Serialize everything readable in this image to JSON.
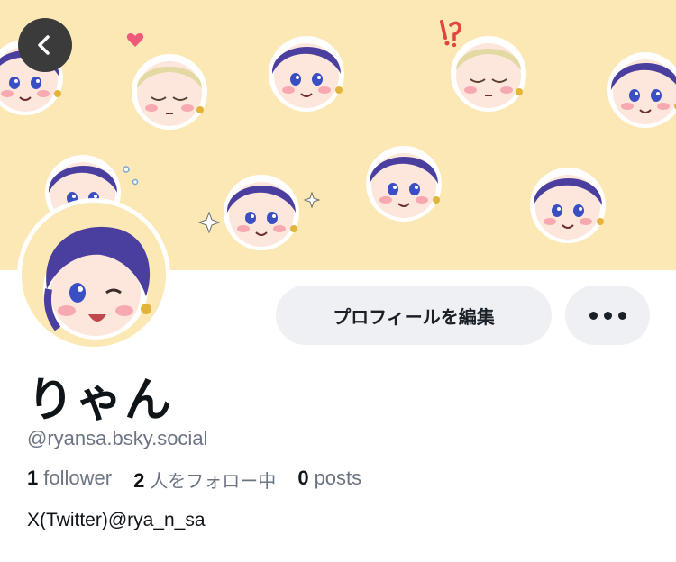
{
  "profile": {
    "display_name": "りゃん",
    "handle": "@ryansa.bsky.social",
    "bio": "X(Twitter)@rya_n_sa"
  },
  "stats": {
    "followers_count": "1",
    "followers_label": "follower",
    "following_count": "2",
    "following_label": "人をフォロー中",
    "posts_count": "0",
    "posts_label": "posts"
  },
  "actions": {
    "edit_profile_label": "プロフィールを編集",
    "back_icon": "chevron-left-icon",
    "more_icon": "more-horizontal-icon"
  },
  "colors": {
    "banner_bg": "#fbe8b4",
    "hair_purple": "#4a3f9e",
    "hair_blond": "#e3d9a2",
    "button_bg": "#eef0f4",
    "text_primary": "#0f1419",
    "text_secondary": "#6b7482"
  }
}
